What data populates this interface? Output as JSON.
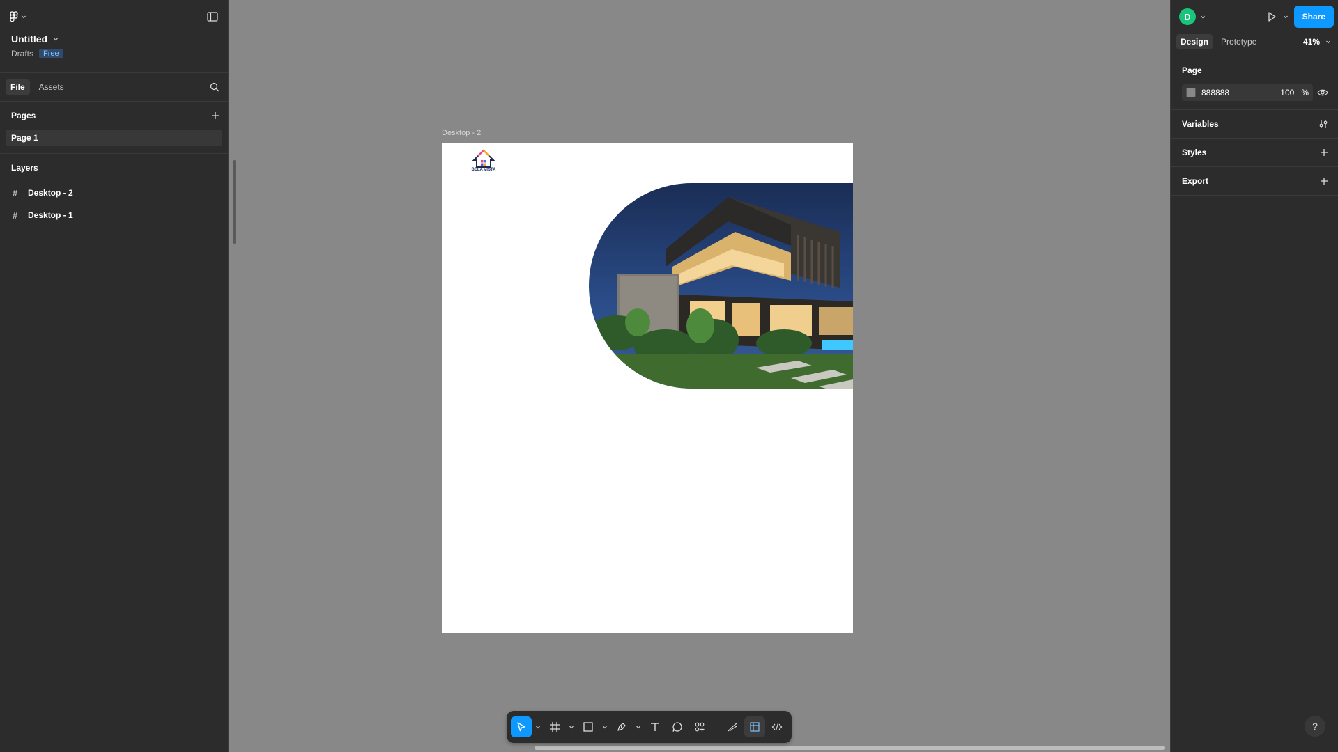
{
  "file": {
    "title": "Untitled",
    "location": "Drafts",
    "plan_badge": "Free"
  },
  "left_tabs": {
    "file": "File",
    "assets": "Assets"
  },
  "pages": {
    "heading": "Pages",
    "items": [
      "Page 1"
    ]
  },
  "layers": {
    "heading": "Layers",
    "items": [
      "Desktop - 2",
      "Desktop - 1"
    ]
  },
  "canvas": {
    "background": "#888888",
    "frame_label": "Desktop - 2",
    "logo_text": "BELA VISTA"
  },
  "right": {
    "avatar_initial": "D",
    "share_label": "Share",
    "tabs": {
      "design": "Design",
      "prototype": "Prototype"
    },
    "zoom": "41%",
    "page_section": {
      "heading": "Page",
      "color_hex": "888888",
      "opacity": "100",
      "percent": "%"
    },
    "variables_heading": "Variables",
    "styles_heading": "Styles",
    "export_heading": "Export",
    "help": "?"
  },
  "colors": {
    "accent": "#0d99ff",
    "avatar": "#1bc47d",
    "panel": "#2c2c2c"
  }
}
